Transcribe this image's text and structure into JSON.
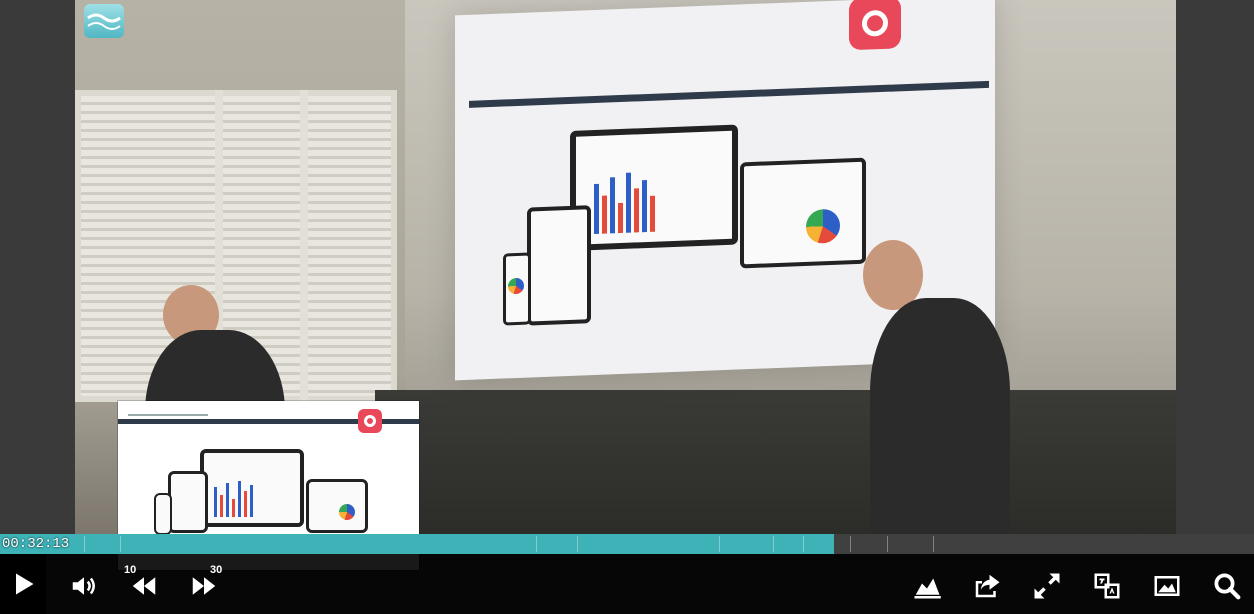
{
  "player": {
    "current_time": "00:32:13",
    "progress": 0.665,
    "accent_color": "#3db3b8"
  },
  "controls": {
    "play_icon": "play-icon",
    "volume_icon": "volume-icon",
    "rewind_icon": "rewind-icon",
    "rewind_seconds": "10",
    "forward_icon": "fast-forward-icon",
    "forward_seconds": "30",
    "right": [
      {
        "name": "statistics-button",
        "icon": "area-chart-icon"
      },
      {
        "name": "share-button",
        "icon": "share-icon"
      },
      {
        "name": "fullscreen-button",
        "icon": "expand-icon"
      },
      {
        "name": "translate-button",
        "icon": "translate-icon"
      },
      {
        "name": "picture-in-picture-button",
        "icon": "image-icon"
      },
      {
        "name": "search-button",
        "icon": "search-icon"
      }
    ]
  },
  "branding": {
    "logo_icon": "waves-logo-icon"
  }
}
